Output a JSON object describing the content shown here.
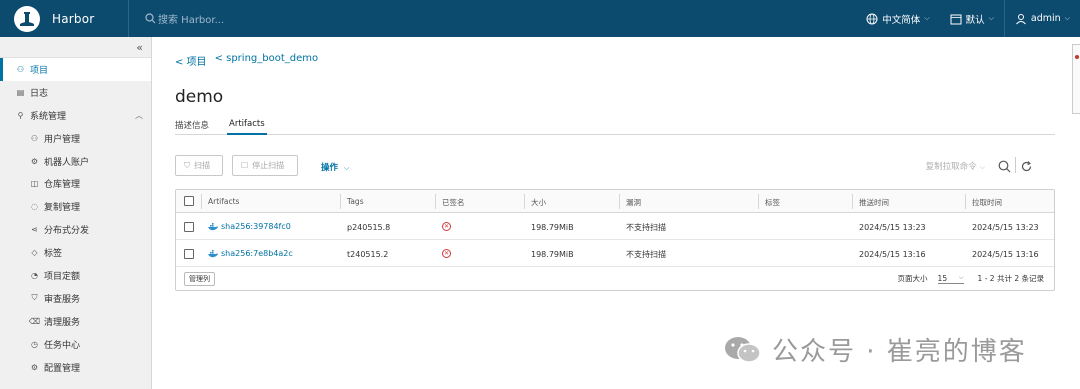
{
  "app": {
    "name": "Harbor"
  },
  "search": {
    "placeholder": "搜索 Harbor..."
  },
  "topbar": {
    "language": "中文简体",
    "theme": "默认",
    "user": "admin"
  },
  "sidebar": {
    "collapse_glyph": "«",
    "items": [
      {
        "label": "项目",
        "icon": "projects-icon",
        "active": true
      },
      {
        "label": "日志",
        "icon": "logs-icon"
      },
      {
        "label": "系统管理",
        "icon": "admin-icon",
        "expanded": true
      }
    ],
    "sub_items": [
      {
        "label": "用户管理",
        "icon": "users-icon"
      },
      {
        "label": "机器人账户",
        "icon": "robot-icon"
      },
      {
        "label": "仓库管理",
        "icon": "registry-icon"
      },
      {
        "label": "复制管理",
        "icon": "replication-icon"
      },
      {
        "label": "分布式分发",
        "icon": "distribution-icon"
      },
      {
        "label": "标签",
        "icon": "tag-icon"
      },
      {
        "label": "项目定额",
        "icon": "quota-icon"
      },
      {
        "label": "审查服务",
        "icon": "shield-icon"
      },
      {
        "label": "清理服务",
        "icon": "trash-icon"
      },
      {
        "label": "任务中心",
        "icon": "clock-icon"
      },
      {
        "label": "配置管理",
        "icon": "gear-icon"
      }
    ]
  },
  "breadcrumb": {
    "project": "< 项目",
    "repo": "< spring_boot_demo"
  },
  "page_title": "demo",
  "tabs": [
    {
      "label": "描述信息",
      "active": false
    },
    {
      "label": "Artifacts",
      "active": true
    }
  ],
  "toolbar": {
    "scan": "扫描",
    "stop_scan": "停止扫描",
    "actions": "操作",
    "copy_pull": "复制拉取命令"
  },
  "table": {
    "columns": [
      "Artifacts",
      "Tags",
      "已签名",
      "大小",
      "漏洞",
      "标签",
      "推送时间",
      "拉取时间"
    ],
    "rows": [
      {
        "artifact": "sha256:39784fc0",
        "tags": "p240515.8",
        "size": "198.79MiB",
        "vulnerabilities": "不支持扫描",
        "labels": "",
        "push_time": "2024/5/15 13:23",
        "pull_time": "2024/5/15 13:23"
      },
      {
        "artifact": "sha256:7e8b4a2c",
        "tags": "t240515.2",
        "size": "198.79MiB",
        "vulnerabilities": "不支持扫描",
        "labels": "",
        "push_time": "2024/5/15 13:16",
        "pull_time": "2024/5/15 13:16"
      }
    ],
    "column_manager": "管理列",
    "page_size_label": "页面大小",
    "page_size": "15",
    "summary": "1 - 2 共计 2 条记录"
  },
  "watermark": {
    "text": "公众号 · 崔亮的博客"
  },
  "colors": {
    "header": "#0c4a6e",
    "accent": "#0072a3",
    "sidebar": "#f0f0f0",
    "error": "#d63a3a"
  }
}
